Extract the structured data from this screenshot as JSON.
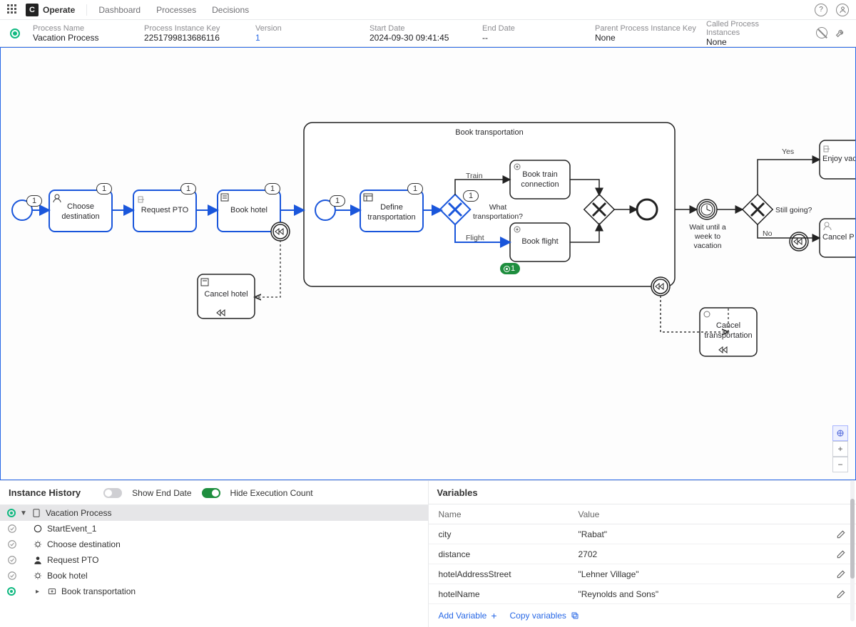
{
  "app": {
    "product_name": "Operate",
    "logo_letter": "C"
  },
  "nav": {
    "dashboard": "Dashboard",
    "processes": "Processes",
    "decisions": "Decisions"
  },
  "header": {
    "labels": {
      "process_name": "Process Name",
      "instance_key": "Process Instance Key",
      "version": "Version",
      "start_date": "Start Date",
      "end_date": "End Date",
      "parent_key": "Parent Process Instance Key",
      "called_instances": "Called Process Instances"
    },
    "values": {
      "process_name": "Vacation Process",
      "instance_key": "2251799813686116",
      "version": "1",
      "start_date": "2024-09-30 09:41:45",
      "end_date": "--",
      "parent_key": "None",
      "called_instances": "None"
    }
  },
  "diagram": {
    "subprocess_label": "Book transportation",
    "nodes": {
      "choose_destination": "Choose destination",
      "request_pto": "Request PTO",
      "book_hotel": "Book hotel",
      "define_transportation": "Define transportation",
      "what_transportation": "What transportation?",
      "book_train": "Book train connection",
      "book_flight": "Book flight",
      "wait_week": "Wait until a week to vacation",
      "still_going": "Still going?",
      "enjoy_vac": "Enjoy vac",
      "cancel_p": "Cancel P",
      "cancel_hotel": "Cancel hotel",
      "cancel_transportation": "Cancel transportation"
    },
    "edge_labels": {
      "train": "Train",
      "flight": "Flight",
      "yes": "Yes",
      "no": "No"
    },
    "badges": {
      "start": "1",
      "choose": "1",
      "request": "1",
      "hotel": "1",
      "sub_start": "1",
      "define": "1",
      "gateway": "1",
      "flight_active": "1"
    }
  },
  "panels": {
    "history": {
      "title": "Instance History",
      "show_end_date": "Show End Date",
      "hide_exec": "Hide Execution Count",
      "rows": {
        "root": "Vacation Process",
        "start_event": "StartEvent_1",
        "choose": "Choose destination",
        "request": "Request PTO",
        "hotel": "Book hotel",
        "transport": "Book transportation"
      }
    },
    "variables": {
      "title": "Variables",
      "col_name": "Name",
      "col_value": "Value",
      "rows": [
        {
          "name": "city",
          "value": "\"Rabat\""
        },
        {
          "name": "distance",
          "value": "2702"
        },
        {
          "name": "hotelAddressStreet",
          "value": "\"Lehner Village\""
        },
        {
          "name": "hotelName",
          "value": "\"Reynolds and Sons\""
        }
      ],
      "add_variable": "Add Variable",
      "copy_variables": "Copy variables"
    }
  }
}
